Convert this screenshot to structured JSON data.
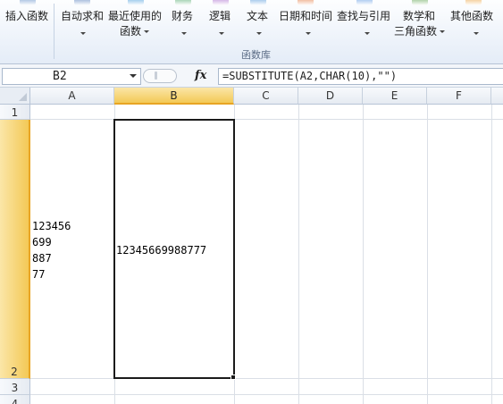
{
  "ribbon": {
    "buttons": [
      {
        "line1": "插入函数",
        "line2": "",
        "icon_color": "#4d7fc2"
      },
      {
        "line1": "自动求和",
        "line2": "",
        "icon_color": "#3f6eb5"
      },
      {
        "line1": "最近使用的",
        "line2": "函数",
        "icon_color": "#2f8fd8"
      },
      {
        "line1": "财务",
        "line2": "",
        "icon_color": "#3aa05a"
      },
      {
        "line1": "逻辑",
        "line2": "",
        "icon_color": "#a05ac8"
      },
      {
        "line1": "文本",
        "line2": "",
        "icon_color": "#3d8ad6"
      },
      {
        "line1": "日期和时间",
        "line2": "",
        "icon_color": "#e06a2a"
      },
      {
        "line1": "查找与引用",
        "line2": "",
        "icon_color": "#4a8de0"
      },
      {
        "line1": "数学和",
        "line2": "三角函数",
        "icon_color": "#4b9a3c"
      },
      {
        "line1": "其他函数",
        "line2": "",
        "icon_color": "#e89a2c"
      }
    ],
    "group_label": "函数库"
  },
  "formula_bar": {
    "name_box": "B2",
    "fx_label": "fx",
    "formula": "=SUBSTITUTE(A2,CHAR(10),\"\")"
  },
  "grid": {
    "columns": [
      "A",
      "B",
      "C",
      "D",
      "E",
      "F"
    ],
    "rows": [
      "1",
      "2",
      "3",
      "4"
    ],
    "selected_cell": "B2",
    "cells": {
      "A2": "123456\n699\n887\n77",
      "B2": "12345669988777"
    }
  },
  "colors": {
    "selection_header": "#f3c956",
    "selection_accent": "#e8a524",
    "gridline": "#dadfe6"
  }
}
